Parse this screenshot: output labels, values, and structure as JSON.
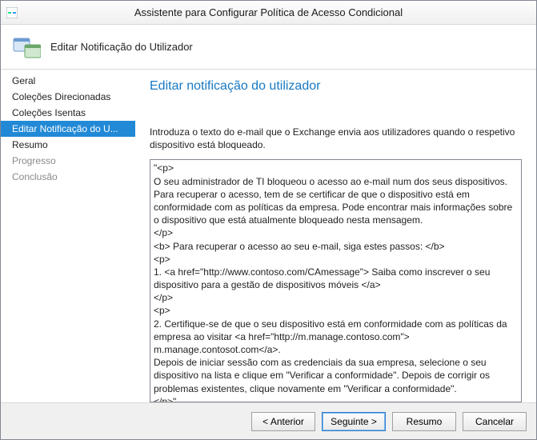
{
  "window": {
    "title": "Assistente para Configurar Política de Acesso Condicional"
  },
  "header": {
    "title": "Editar Notificação do Utilizador"
  },
  "sidebar": {
    "items": [
      {
        "label": "Geral",
        "state": "normal"
      },
      {
        "label": "Coleções Direcionadas",
        "state": "normal"
      },
      {
        "label": "Coleções Isentas",
        "state": "normal"
      },
      {
        "label": "Editar Notificação do U...",
        "state": "selected"
      },
      {
        "label": "Resumo",
        "state": "normal"
      },
      {
        "label": "Progresso",
        "state": "disabled"
      },
      {
        "label": "Conclusão",
        "state": "disabled"
      }
    ]
  },
  "main": {
    "heading": "Editar notificação do utilizador",
    "instruction": "Introduza o texto do e-mail que o Exchange envia aos utilizadores quando o respetivo dispositivo está bloqueado.",
    "notification_text": "\"<p>\nO seu administrador de TI bloqueou o acesso ao e-mail num dos seus dispositivos. Para recuperar o acesso, tem de se certificar de que o dispositivo está em conformidade com as políticas da empresa. Pode encontrar mais informações sobre o dispositivo que está atualmente bloqueado nesta mensagem.\n</p>\n<b> Para recuperar o acesso ao seu e-mail, siga estes passos: </b>\n<p>\n1. <a href=\"http://www.contoso.com/CAmessage\"> Saiba como inscrever o seu dispositivo para a gestão de dispositivos móveis </a>\n</p>\n<p>\n2. Certifique-se de que o seu dispositivo está em conformidade com as políticas da empresa ao visitar <a href=\"http://m.manage.contoso.com\"> m.manage.contosot.com</a>.\nDepois de iniciar sessão com as credenciais da sua empresa, selecione o seu dispositivo na lista e clique em \"Verificar a conformidade\". Depois de corrigir os problemas existentes, clique novamente em \"Verificar a conformidade\".\n</p>\""
  },
  "footer": {
    "previous": "< Anterior",
    "next": "Seguinte >",
    "summary": "Resumo",
    "cancel": "Cancelar"
  },
  "colors": {
    "accent": "#1979c3",
    "selection": "#2189d6"
  }
}
